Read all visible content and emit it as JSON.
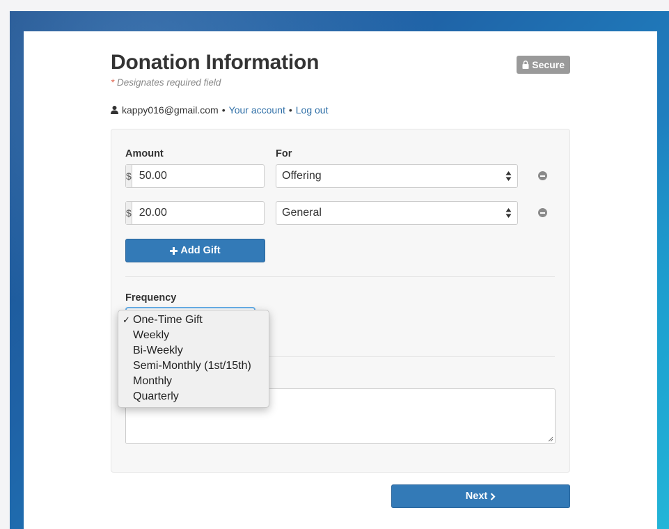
{
  "header": {
    "title": "Donation Information",
    "required_note_star": "*",
    "required_note": "Designates required field",
    "secure_badge": "Secure"
  },
  "account": {
    "email": "kappy016@gmail.com",
    "separator": "•",
    "your_account_link": "Your account",
    "logout_link": "Log out"
  },
  "gifts": {
    "amount_label": "Amount",
    "for_label": "For",
    "currency_symbol": "$",
    "rows": [
      {
        "amount": "50.00",
        "fund": "Offering"
      },
      {
        "amount": "20.00",
        "fund": "General"
      }
    ],
    "add_gift_label": "Add Gift"
  },
  "frequency": {
    "label": "Frequency",
    "options": [
      "One-Time Gift",
      "Weekly",
      "Bi-Weekly",
      "Semi-Monthly (1st/15th)",
      "Monthly",
      "Quarterly"
    ],
    "selected_mark": "✓"
  },
  "footer": {
    "next_label": "Next"
  },
  "colors": {
    "primary": "#337ab7",
    "link": "#2f6fa7",
    "badge": "#9a9a9a",
    "required_star": "#e06b57"
  }
}
